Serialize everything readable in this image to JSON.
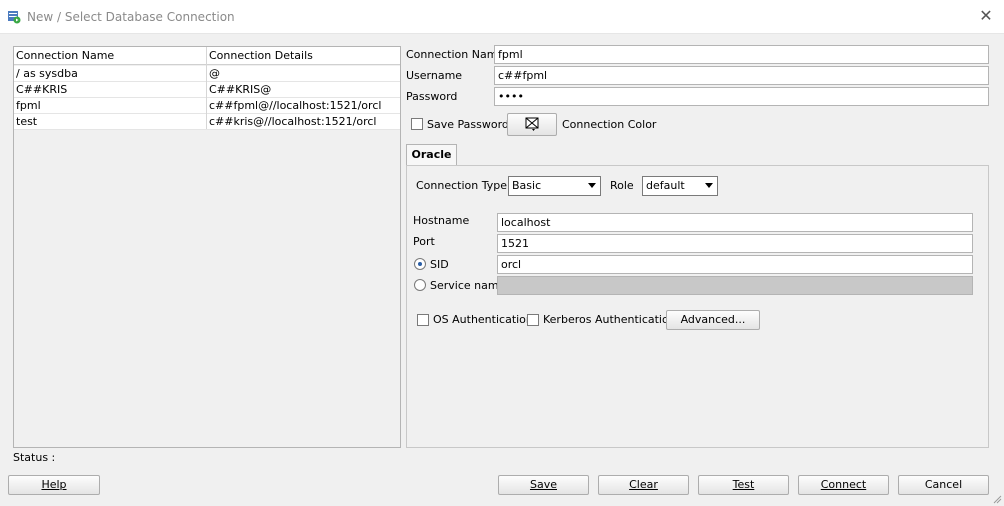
{
  "window": {
    "title": "New / Select Database Connection"
  },
  "list": {
    "headers": {
      "name": "Connection Name",
      "details": "Connection Details"
    },
    "rows": [
      {
        "name": "/ as sysdba",
        "details": "@"
      },
      {
        "name": "C##KRIS",
        "details": "C##KRIS@"
      },
      {
        "name": "fpml",
        "details": "c##fpml@//localhost:1521/orcl"
      },
      {
        "name": "test",
        "details": "c##kris@//localhost:1521/orcl"
      }
    ]
  },
  "form": {
    "connection_name_label": "Connection Name",
    "connection_name_value": "fpml",
    "username_label": "Username",
    "username_value": "c##fpml",
    "password_label": "Password",
    "password_value": "••••",
    "save_password_label": "Save Password",
    "connection_color_label": "Connection Color"
  },
  "tab": {
    "label": "Oracle"
  },
  "oracle": {
    "connection_type_label": "Connection Type",
    "connection_type_value": "Basic",
    "role_label": "Role",
    "role_value": "default",
    "hostname_label": "Hostname",
    "hostname_value": "localhost",
    "port_label": "Port",
    "port_value": "1521",
    "sid_label": "SID",
    "sid_value": "orcl",
    "service_name_label": "Service name",
    "os_auth_label": "OS Authentication",
    "kerberos_label": "Kerberos Authentication",
    "advanced_label": "Advanced..."
  },
  "status": {
    "label": "Status :"
  },
  "buttons": {
    "help": "Help",
    "save": "Save",
    "clear": "Clear",
    "test": "Test",
    "connect": "Connect",
    "cancel": "Cancel"
  }
}
